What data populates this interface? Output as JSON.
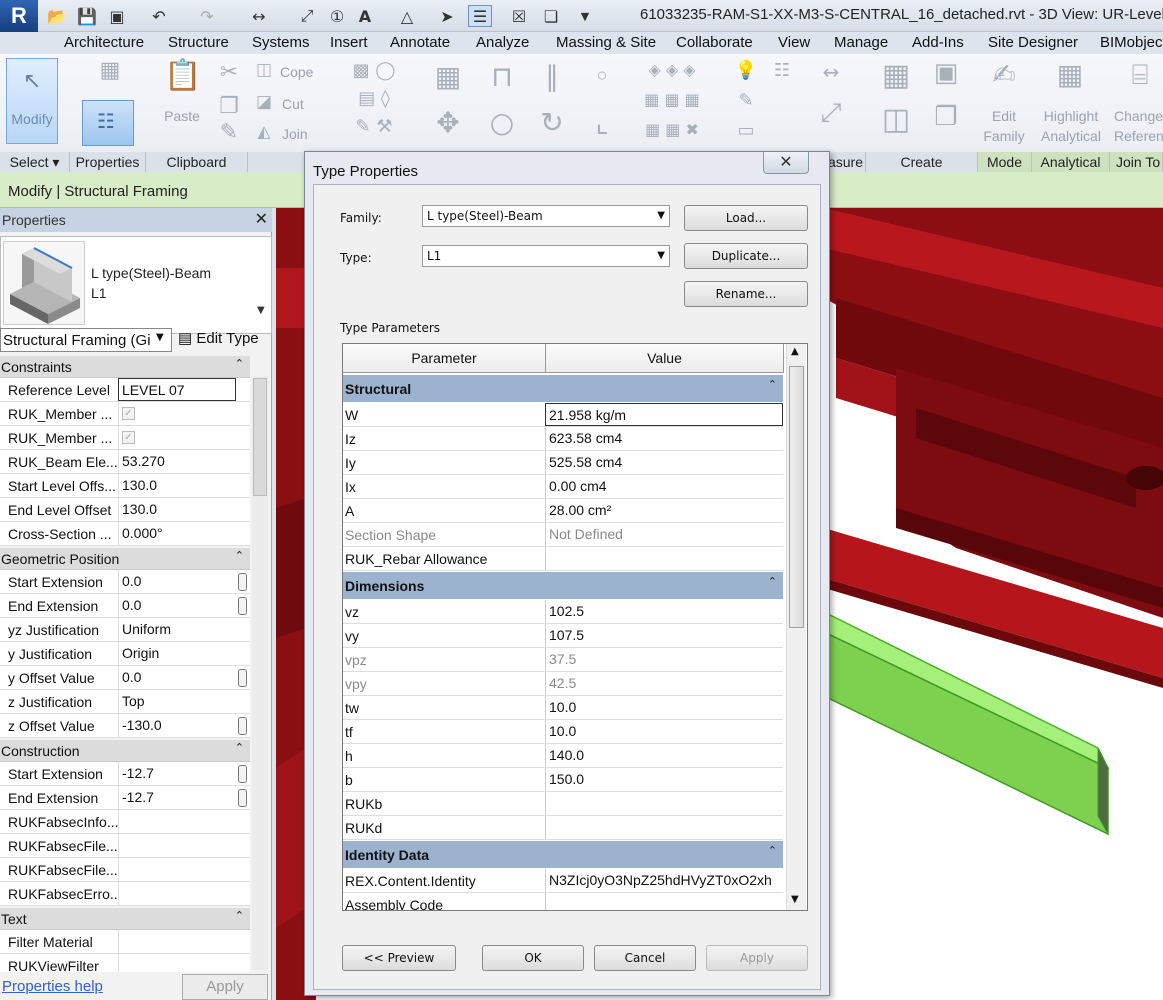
{
  "app": {
    "title": "61033235-RAM-S1-XX-M3-S-CENTRAL_16_detached.rvt - 3D View: UR-Level 07"
  },
  "ribbon_tabs": [
    "Architecture",
    "Structure",
    "Systems",
    "Insert",
    "Annotate",
    "Analyze",
    "Massing & Site",
    "Collaborate",
    "View",
    "Manage",
    "Add-Ins",
    "Site Designer",
    "BIMobject"
  ],
  "ribbon": {
    "modify_label": "Modify",
    "paste_label": "Paste",
    "cope_label": "Cope",
    "cut_label": "Cut",
    "join_label": "Join",
    "edit_family_label": "Edit Family",
    "highlight_analytical_label": "Highlight Analytical",
    "change_reference_label": "Change Reference",
    "panels": [
      "Select",
      "Properties",
      "Clipboard",
      "easure",
      "Create",
      "Mode",
      "Analytical",
      "Join To"
    ]
  },
  "context_bar": "Modify | Structural Framing",
  "properties_palette": {
    "header": "Properties",
    "family": "L type(Steel)-Beam",
    "type": "L1",
    "filter": "Structural Framing (Gi",
    "edit_type": "Edit Type",
    "groups": [
      {
        "label": "Constraints",
        "rows": [
          {
            "name": "Reference Level",
            "value": "LEVEL 07"
          },
          {
            "name": "RUK_Member ...",
            "value": "",
            "check": true
          },
          {
            "name": "RUK_Member ...",
            "value": "",
            "check": true
          },
          {
            "name": "RUK_Beam Ele...",
            "value": "53.270"
          },
          {
            "name": "Start Level Offs...",
            "value": "130.0"
          },
          {
            "name": "End Level Offset",
            "value": "130.0"
          },
          {
            "name": "Cross-Section ...",
            "value": "0.000°"
          }
        ]
      },
      {
        "label": "Geometric Position",
        "rows": [
          {
            "name": "Start Extension",
            "value": "0.0",
            "btn": true
          },
          {
            "name": "End Extension",
            "value": "0.0",
            "btn": true
          },
          {
            "name": "yz Justification",
            "value": "Uniform"
          },
          {
            "name": "y Justification",
            "value": "Origin"
          },
          {
            "name": "y Offset Value",
            "value": "0.0",
            "btn": true
          },
          {
            "name": "z Justification",
            "value": "Top"
          },
          {
            "name": "z Offset Value",
            "value": "-130.0",
            "btn": true
          }
        ]
      },
      {
        "label": "Construction",
        "rows": [
          {
            "name": "Start Extension",
            "value": "-12.7",
            "btn": true
          },
          {
            "name": "End Extension",
            "value": "-12.7",
            "btn": true
          },
          {
            "name": "RUKFabsecInfo...",
            "value": ""
          },
          {
            "name": "RUKFabsecFile...",
            "value": ""
          },
          {
            "name": "RUKFabsecFile...",
            "value": ""
          },
          {
            "name": "RUKFabsecErro...",
            "value": ""
          }
        ]
      },
      {
        "label": "Text",
        "rows": [
          {
            "name": "Filter Material",
            "value": ""
          },
          {
            "name": "RUKViewFilter",
            "value": ""
          }
        ]
      }
    ],
    "help_link": "Properties help",
    "apply": "Apply"
  },
  "dialog": {
    "title": "Type Properties",
    "family_label": "Family:",
    "family_value": "L type(Steel)-Beam",
    "type_label": "Type:",
    "type_value": "L1",
    "load": "Load...",
    "duplicate": "Duplicate...",
    "rename": "Rename...",
    "type_parameters_label": "Type Parameters",
    "col_parameter": "Parameter",
    "col_value": "Value",
    "groups": [
      {
        "label": "Structural",
        "rows": [
          {
            "name": "W",
            "value": "21.958 kg/m",
            "selected": true
          },
          {
            "name": "Iz",
            "value": "623.58 cm4"
          },
          {
            "name": "Iy",
            "value": "525.58 cm4"
          },
          {
            "name": "Ix",
            "value": "0.00 cm4"
          },
          {
            "name": "A",
            "value": "28.00 cm²"
          },
          {
            "name": "Section Shape",
            "value": "Not Defined",
            "grey": true
          },
          {
            "name": "RUK_Rebar Allowance",
            "value": ""
          }
        ]
      },
      {
        "label": "Dimensions",
        "rows": [
          {
            "name": "vz",
            "value": "102.5"
          },
          {
            "name": "vy",
            "value": "107.5"
          },
          {
            "name": "vpz",
            "value": "37.5",
            "grey": true
          },
          {
            "name": "vpy",
            "value": "42.5",
            "grey": true
          },
          {
            "name": "tw",
            "value": "10.0"
          },
          {
            "name": "tf",
            "value": "10.0"
          },
          {
            "name": "h",
            "value": "140.0"
          },
          {
            "name": "b",
            "value": "150.0"
          },
          {
            "name": "RUKb",
            "value": ""
          },
          {
            "name": "RUKd",
            "value": ""
          }
        ]
      },
      {
        "label": "Identity Data",
        "rows": [
          {
            "name": "REX.Content.Identity",
            "value": "N3ZIcj0yO3NpZ25hdHVyZT0xO2xh"
          },
          {
            "name": "Assembly Code",
            "value": ""
          }
        ]
      }
    ],
    "preview": "<< Preview",
    "ok": "OK",
    "cancel": "Cancel",
    "apply": "Apply"
  }
}
